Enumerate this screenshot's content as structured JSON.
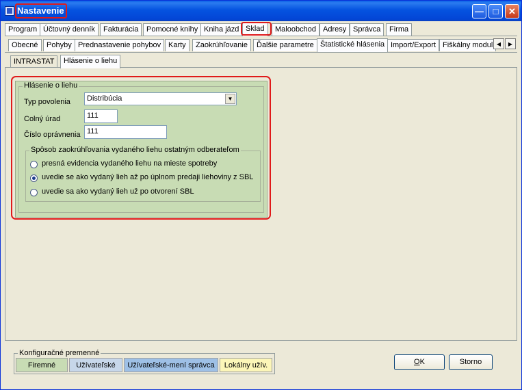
{
  "window": {
    "title": "Nastavenie"
  },
  "main_tabs": [
    {
      "label": "Program"
    },
    {
      "label": "Účtovný denník"
    },
    {
      "label": "Fakturácia"
    },
    {
      "label": "Pomocné knihy"
    },
    {
      "label": "Kniha jázd"
    },
    {
      "label": "Sklad"
    },
    {
      "label": "Maloobchod"
    },
    {
      "label": "Adresy"
    },
    {
      "label": "Správca"
    },
    {
      "label": "Firma"
    }
  ],
  "sub_tabs": [
    {
      "label": "Obecné"
    },
    {
      "label": "Pohyby"
    },
    {
      "label": "Prednastavenie pohybov"
    },
    {
      "label": "Karty"
    },
    {
      "label": "Zaokrúhľovanie"
    },
    {
      "label": "Ďalšie parametre"
    },
    {
      "label": "Štatistické hlásenia"
    },
    {
      "label": "Import/Export"
    },
    {
      "label": "Fiškálny modul"
    }
  ],
  "report_tabs": [
    {
      "label": "INTRASTAT"
    },
    {
      "label": "Hlásenie o liehu"
    }
  ],
  "group": {
    "title": "Hlásenie o liehu",
    "typ_povolenia_label": "Typ povolenia",
    "typ_povolenia_value": "Distribúcia",
    "colny_urad_label": "Colný úrad",
    "colny_urad_value": "111",
    "cislo_opravnenia_label": "Číslo oprávnenia",
    "cislo_opravnenia_value": "111"
  },
  "rounding": {
    "title": "Spôsob zaokrúhľovania vydaného liehu ostatným odberateľom",
    "options": [
      {
        "label": "presná evidencia vydaného liehu na mieste spotreby",
        "checked": false
      },
      {
        "label": "uvedie se ako vydaný lieh až po úplnom predaji liehoviny z SBL",
        "checked": true
      },
      {
        "label": "uvedie sa ako vydaný lieh už po otvorení SBL",
        "checked": false
      }
    ]
  },
  "config": {
    "title": "Konfiguračné premenné",
    "items": [
      {
        "label": "Firemné",
        "color": "#c8dcb4"
      },
      {
        "label": "Užívateľské",
        "color": "#c7d7ea"
      },
      {
        "label": "Užívateľské-mení správca",
        "color": "#9ec0e6"
      },
      {
        "label": "Lokálny užív.",
        "color": "#fcf6b8"
      }
    ]
  },
  "buttons": {
    "ok_rest": "K",
    "ok_underlined": "O",
    "storno": "Storno"
  }
}
